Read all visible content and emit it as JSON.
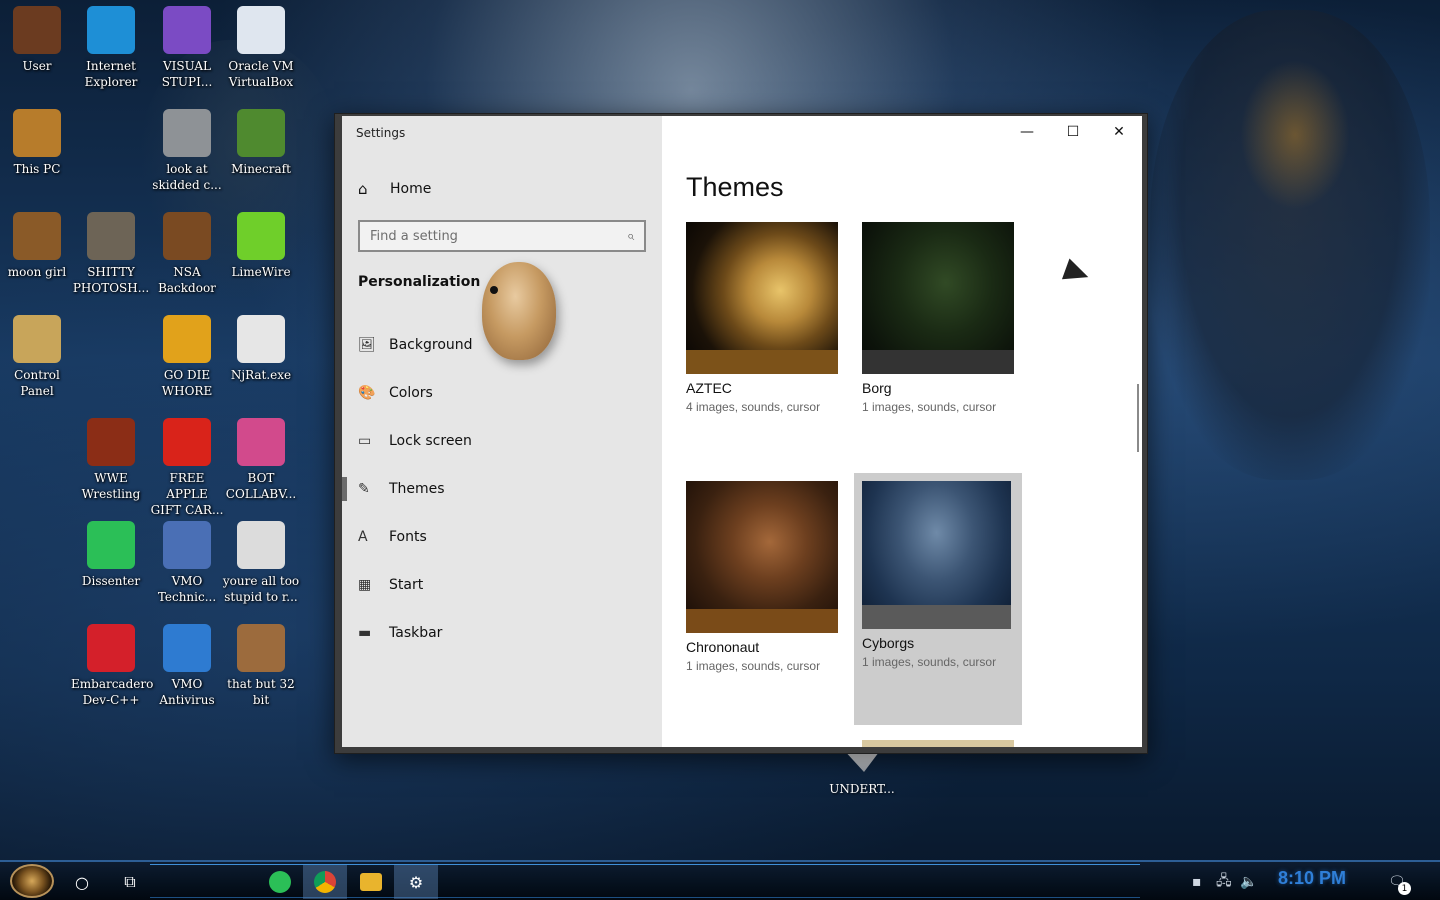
{
  "desktop_icons": [
    {
      "id": "user",
      "label": "User",
      "icon": "user-folder-icon",
      "color": "#6b3b20"
    },
    {
      "id": "internet-explorer",
      "label": "Internet\nExplorer",
      "icon": "edge-icon",
      "color": "#1e8fd6"
    },
    {
      "id": "visual-studio",
      "label": "VISUAL\nSTUPI...",
      "icon": "visual-studio-icon",
      "color": "#7b4bc4"
    },
    {
      "id": "virtualbox",
      "label": "Oracle VM\nVirtualBox",
      "icon": "virtualbox-icon",
      "color": "#dfe6ef"
    },
    {
      "id": "this-pc",
      "label": "This PC",
      "icon": "computer-icon",
      "color": "#b77c2b"
    },
    {
      "id": "look-at",
      "label": "look at\nskidded c...",
      "icon": "copy-files-icon",
      "color": "#8e9296"
    },
    {
      "id": "minecraft",
      "label": "Minecraft",
      "icon": "minecraft-icon",
      "color": "#4f8a2f"
    },
    {
      "id": "moon-girl",
      "label": "moon girl",
      "icon": "treasure-icon",
      "color": "#8a5a28"
    },
    {
      "id": "shitty-photoshop",
      "label": "SHITTY\nPHOTOSH...",
      "icon": "gimp-icon",
      "color": "#6d6456"
    },
    {
      "id": "nsa-backdoor",
      "label": "NSA\nBackdoor",
      "icon": "gear-box-icon",
      "color": "#7a4a22"
    },
    {
      "id": "limewire",
      "label": "LimeWire",
      "icon": "limewire-icon",
      "color": "#6fcf2a"
    },
    {
      "id": "control-panel",
      "label": "Control\nPanel",
      "icon": "lightbulb-icon",
      "color": "#c8a55a"
    },
    {
      "id": "go-die",
      "label": "GO DIE\nWHORE",
      "icon": "de-app-icon",
      "color": "#e1a21b"
    },
    {
      "id": "njrat",
      "label": "NjRat.exe",
      "icon": "skull-icon",
      "color": "#e6e6e6"
    },
    {
      "id": "wwe",
      "label": "WWE\nWrestling",
      "icon": "radio-icon",
      "color": "#8b2d16"
    },
    {
      "id": "apple-gift",
      "label": "FREE APPLE\nGIFT CAR...",
      "icon": "apple-icon",
      "color": "#d9231a"
    },
    {
      "id": "bot-collab",
      "label": "BOT\nCOLLABV...",
      "icon": "monitor-pink-icon",
      "color": "#d24a8c"
    },
    {
      "id": "dissenter",
      "label": "Dissenter",
      "icon": "dissenter-icon",
      "color": "#2bbf57"
    },
    {
      "id": "vmo-technic",
      "label": "VMO\nTechnic...",
      "icon": "doctor-icon",
      "color": "#4a6fb5"
    },
    {
      "id": "youre-all",
      "label": "youre all too\nstupid to r...",
      "icon": "portrait-icon",
      "color": "#dcdcdc"
    },
    {
      "id": "embarcadero",
      "label": "Embarcadero\nDev-C++",
      "icon": "devcpp-icon",
      "color": "#d4202a"
    },
    {
      "id": "vmo-antivirus",
      "label": "VMO\nAntivirus",
      "icon": "shield-icon",
      "color": "#2e7bd1"
    },
    {
      "id": "that-but",
      "label": "that but 32\nbit",
      "icon": "painting-icon",
      "color": "#9c6b3d"
    }
  ],
  "undert_icon": {
    "label": "UNDERT..."
  },
  "settings": {
    "title": "Settings",
    "home_label": "Home",
    "search_placeholder": "Find a setting",
    "section_title": "Personalization",
    "nav_items": [
      {
        "label": "Background",
        "icon": "image-icon"
      },
      {
        "label": "Colors",
        "icon": "palette-icon"
      },
      {
        "label": "Lock screen",
        "icon": "lock-screen-icon"
      },
      {
        "label": "Themes",
        "icon": "themes-icon",
        "active": true
      },
      {
        "label": "Fonts",
        "icon": "fonts-icon"
      },
      {
        "label": "Start",
        "icon": "start-icon"
      },
      {
        "label": "Taskbar",
        "icon": "taskbar-icon"
      }
    ],
    "page_title": "Themes",
    "themes": [
      {
        "name": "AZTEC",
        "meta": "4 images, sounds, cursor"
      },
      {
        "name": "Borg",
        "meta": "1 images, sounds, cursor"
      },
      {
        "name": "Chrononaut",
        "meta": "1 images, sounds, cursor"
      },
      {
        "name": "Cyborgs",
        "meta": "1 images, sounds, cursor",
        "selected": true
      }
    ]
  },
  "taskbar": {
    "apps": [
      "dissenter-icon",
      "chrome-icon",
      "file-explorer-icon",
      "settings-gear-icon"
    ],
    "clock": "8:10 PM",
    "notification_count": "1"
  }
}
